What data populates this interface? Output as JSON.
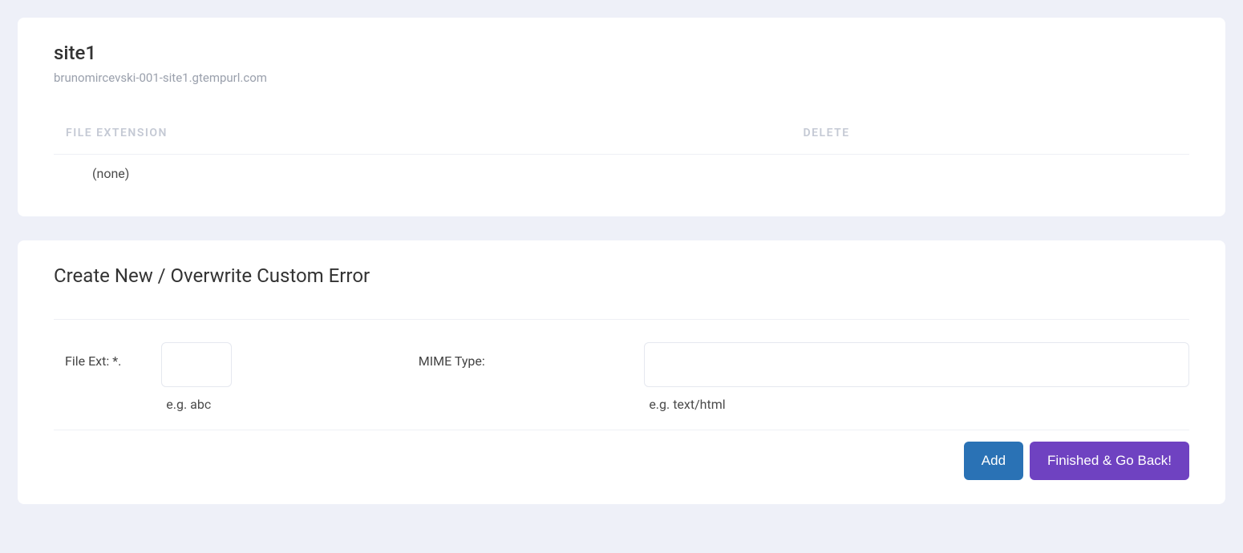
{
  "site": {
    "title": "site1",
    "url": "brunomircevski-001-site1.gtempurl.com"
  },
  "table": {
    "headers": {
      "file_extension": "FILE EXTENSION",
      "delete": "DELETE"
    },
    "rows": [
      {
        "file_extension": "(none)"
      }
    ]
  },
  "form": {
    "section_title": "Create New / Overwrite Custom Error",
    "file_ext_label": "File Ext:  *.",
    "file_ext_value": "",
    "file_ext_hint": "e.g. abc",
    "mime_type_label": "MIME Type:",
    "mime_type_value": "",
    "mime_type_hint": "e.g. text/html",
    "buttons": {
      "add": "Add",
      "finished": "Finished & Go Back!"
    }
  },
  "colors": {
    "page_bg": "#eef0f8",
    "card_bg": "#ffffff",
    "primary_btn": "#2a72b5",
    "secondary_btn": "#6f42c1"
  }
}
